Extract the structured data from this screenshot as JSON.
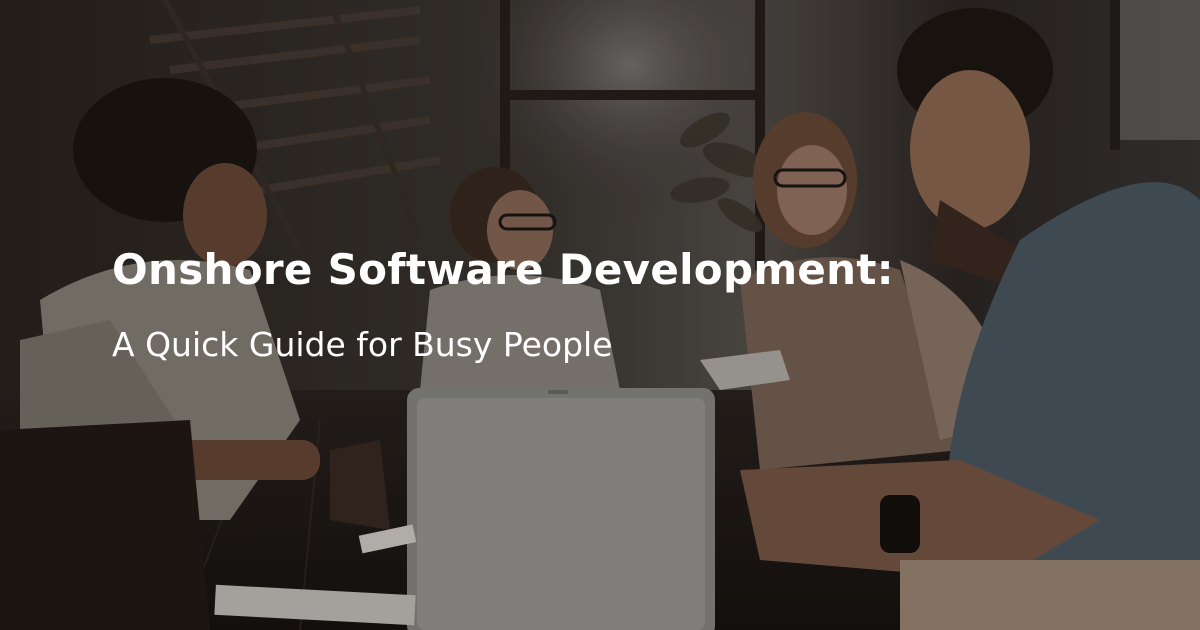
{
  "banner": {
    "headline": "Onshore Software Development:",
    "subheadline": "A Quick Guide for Busy People",
    "text_color": "#ffffff",
    "overlay_color": "#1b1714"
  }
}
